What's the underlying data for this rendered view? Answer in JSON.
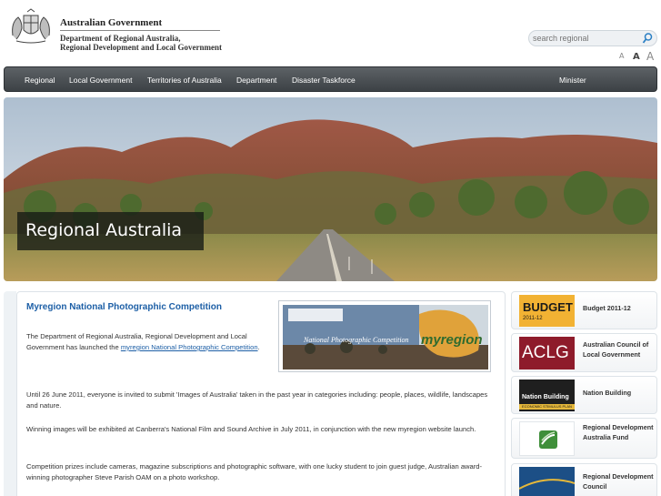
{
  "header": {
    "gov_title": "Australian Government",
    "dept_line1": "Department of Regional Australia,",
    "dept_line2": "Regional Development and Local Government"
  },
  "search": {
    "placeholder": "search regional"
  },
  "text_size": {
    "small": "A",
    "medium": "A",
    "large": "A"
  },
  "nav": {
    "items": [
      "Regional",
      "Local Government",
      "Territories of Australia",
      "Department",
      "Disaster Taskforce"
    ],
    "minister": "Minister"
  },
  "hero": {
    "title": "Regional Australia"
  },
  "article": {
    "title": "Myregion National Photographic Competition",
    "intro_text": "The Department of Regional Australia, Regional Development and Local Government has launched the ",
    "intro_link": "myregion National Photographic Competition",
    "intro_end": ".",
    "para2": "Until 26 June 2011, everyone is invited to submit 'Images of Australia' taken in the past year in categories including: people, places, wildlife, landscapes and nature.",
    "para3": "Winning images will be exhibited at Canberra's National Film and Sound Archive in July 2011, in conjunction with the new myregion website launch.",
    "para4": "Competition prizes include cameras, magazine subscriptions and photographic software, with one lucky student to join guest judge, Australian award-winning photographer Steve Parish OAM on a photo workshop.",
    "promo_caption": "National Photographic Competition",
    "promo_logo": "myregion"
  },
  "cards": [
    {
      "label": "Budget 2011-12",
      "thumb_text": "BUDGET",
      "thumb_sub": "2011-12",
      "color": "#f2b233"
    },
    {
      "label": "Australian Council of Local Government",
      "thumb_text": "ACLG",
      "color": "#8e1b2b"
    },
    {
      "label": "Nation Building",
      "thumb_text": "Nation Building",
      "thumb_sub": "ECONOMIC STIMULUS PLAN",
      "color": "#1f1f1f"
    },
    {
      "label": "Regional Development Australia Fund",
      "color": "#ffffff"
    },
    {
      "label": "Regional Development Council",
      "color": "#1c4f86"
    }
  ],
  "colors": {
    "accent": "#1d5fa6",
    "nav_bg": "#4a4f53"
  }
}
